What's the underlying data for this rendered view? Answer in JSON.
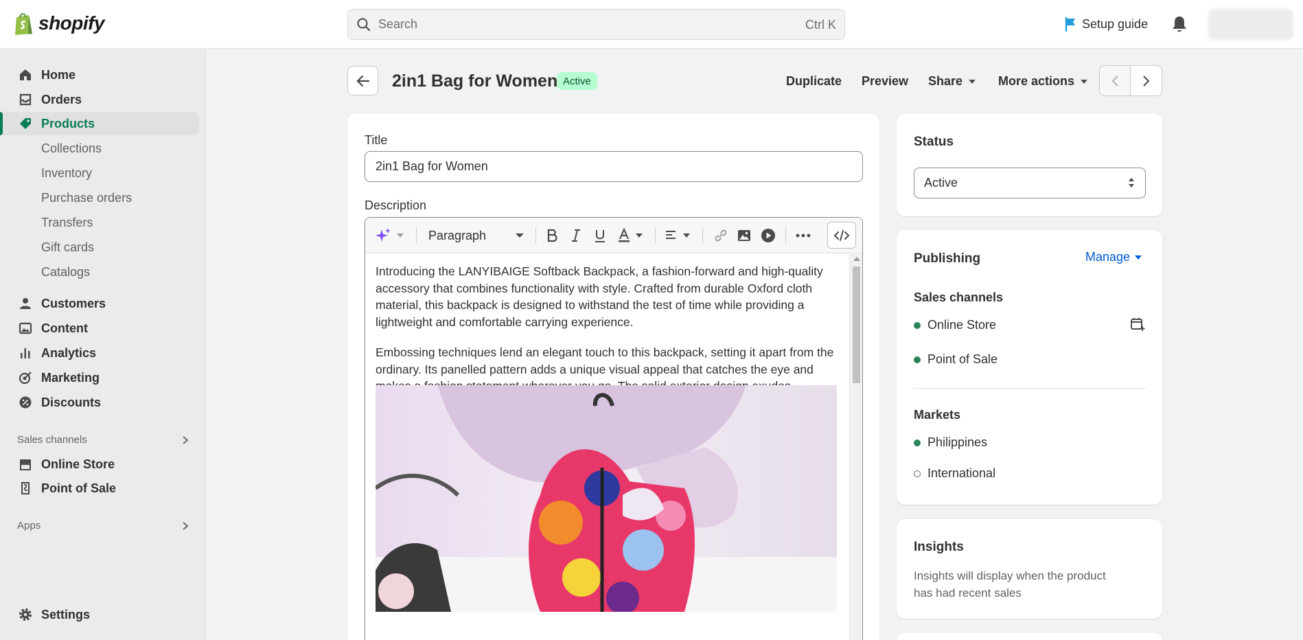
{
  "brand": {
    "name": "shopify"
  },
  "topbar": {
    "search_placeholder": "Search",
    "search_shortcut": "Ctrl K",
    "setup_guide": "Setup guide"
  },
  "sidebar": {
    "items": [
      {
        "label": "Home",
        "icon": "home-icon"
      },
      {
        "label": "Orders",
        "icon": "inbox-icon"
      },
      {
        "label": "Products",
        "icon": "tag-icon",
        "active": true
      },
      {
        "label": "Customers",
        "icon": "person-icon"
      },
      {
        "label": "Content",
        "icon": "image-icon"
      },
      {
        "label": "Analytics",
        "icon": "bar-chart-icon"
      },
      {
        "label": "Marketing",
        "icon": "target-icon"
      },
      {
        "label": "Discounts",
        "icon": "discount-icon"
      }
    ],
    "product_subitems": [
      "Collections",
      "Inventory",
      "Purchase orders",
      "Transfers",
      "Gift cards",
      "Catalogs"
    ],
    "sales_channels_label": "Sales channels",
    "sales_channels": [
      {
        "label": "Online Store",
        "icon": "store-icon"
      },
      {
        "label": "Point of Sale",
        "icon": "pos-icon"
      }
    ],
    "apps_label": "Apps",
    "settings_label": "Settings"
  },
  "header": {
    "title": "2in1 Bag for Women",
    "status_badge": "Active",
    "actions": {
      "duplicate": "Duplicate",
      "preview": "Preview",
      "share": "Share",
      "more_actions": "More actions"
    }
  },
  "product_form": {
    "title_label": "Title",
    "title_value": "2in1 Bag for Women",
    "description_label": "Description",
    "toolbar": {
      "format_value": "Paragraph"
    },
    "description_paragraphs": [
      "Introducing the LANYIBAIGE Softback Backpack, a fashion-forward and high-quality accessory that combines functionality with style. Crafted from durable Oxford cloth material, this backpack is designed to withstand the test of time while providing a lightweight and comfortable carrying experience.",
      "Embossing techniques lend an elegant touch to this backpack, setting it apart from the ordinary. Its panelled pattern adds a unique visual appeal that catches the eye and makes a fashion statement wherever you go. The solid exterior design exudes sophistication and versatility, making it suitable for various occasions."
    ]
  },
  "status_card": {
    "title": "Status",
    "selected": "Active"
  },
  "publishing_card": {
    "title": "Publishing",
    "manage_label": "Manage",
    "sales_channels_label": "Sales channels",
    "channels": [
      "Online Store",
      "Point of Sale"
    ],
    "markets_label": "Markets",
    "markets": [
      {
        "label": "Philippines",
        "active": true
      },
      {
        "label": "International",
        "active": false
      }
    ]
  },
  "insights_card": {
    "title": "Insights",
    "text": "Insights will display when the product has had recent sales"
  },
  "colors": {
    "accent_green": "#087d54",
    "link_blue": "#005bd3",
    "badge_bg": "#b4fed2"
  }
}
